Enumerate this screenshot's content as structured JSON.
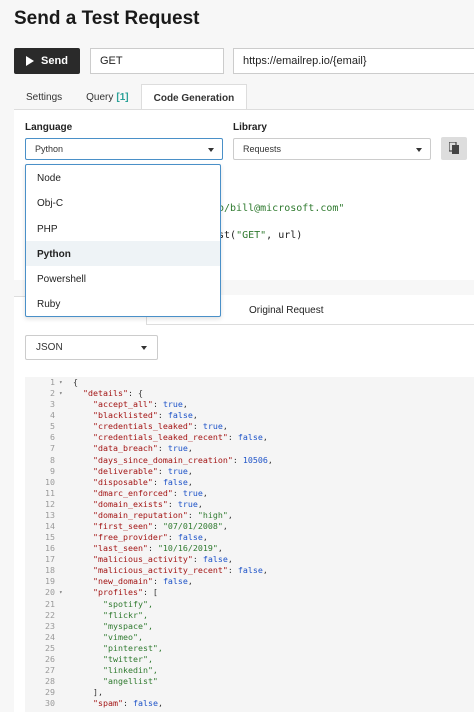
{
  "page": {
    "title": "Send a Test Request"
  },
  "request": {
    "send_label": "Send",
    "method": "GET",
    "url": "https://emailrep.io/{email}"
  },
  "tabs": [
    {
      "label": "Settings"
    },
    {
      "label": "Query",
      "count": "[1]"
    },
    {
      "label": "Code Generation",
      "active": true
    }
  ],
  "code_generation": {
    "language_label": "Language",
    "language_value": "Python",
    "library_label": "Library",
    "library_value": "Requests",
    "code_fragment_1": "o/bill@microsoft.com\"",
    "code_fragment_2a": "st(",
    "code_fragment_2b": "\"GET\"",
    "code_fragment_2c": ", url)",
    "language_options": [
      "Node",
      "Obj-C",
      "PHP",
      "Python",
      "Powershell",
      "Ruby"
    ],
    "selected_option": "Python"
  },
  "response": {
    "tab_label": "Original Request",
    "format": "JSON",
    "lines": [
      {
        "n": "1",
        "fold": "▾",
        "html": "{"
      },
      {
        "n": "2",
        "fold": "▾",
        "key": "details",
        "rest": ": {",
        "indent": "  "
      },
      {
        "n": "3",
        "key": "accept_all",
        "bool": "true",
        "indent": "    "
      },
      {
        "n": "4",
        "key": "blacklisted",
        "bool": "false",
        "indent": "    "
      },
      {
        "n": "5",
        "key": "credentials_leaked",
        "bool": "true",
        "indent": "    "
      },
      {
        "n": "6",
        "key": "credentials_leaked_recent",
        "bool": "false",
        "indent": "    "
      },
      {
        "n": "7",
        "key": "data_breach",
        "bool": "true",
        "indent": "    "
      },
      {
        "n": "8",
        "key": "days_since_domain_creation",
        "num": "10506",
        "indent": "    "
      },
      {
        "n": "9",
        "key": "deliverable",
        "bool": "true",
        "indent": "    "
      },
      {
        "n": "10",
        "key": "disposable",
        "bool": "false",
        "indent": "    "
      },
      {
        "n": "11",
        "key": "dmarc_enforced",
        "bool": "true",
        "indent": "    "
      },
      {
        "n": "12",
        "key": "domain_exists",
        "bool": "true",
        "indent": "    "
      },
      {
        "n": "13",
        "key": "domain_reputation",
        "str": "\"high\"",
        "indent": "    "
      },
      {
        "n": "14",
        "key": "first_seen",
        "str": "\"07/01/2008\"",
        "indent": "    "
      },
      {
        "n": "15",
        "key": "free_provider",
        "bool": "false",
        "indent": "    "
      },
      {
        "n": "16",
        "key": "last_seen",
        "str": "\"10/16/2019\"",
        "indent": "    "
      },
      {
        "n": "17",
        "key": "malicious_activity",
        "bool": "false",
        "indent": "    "
      },
      {
        "n": "18",
        "key": "malicious_activity_recent",
        "bool": "false",
        "indent": "    "
      },
      {
        "n": "19",
        "key": "new_domain",
        "bool": "false",
        "indent": "    "
      },
      {
        "n": "20",
        "fold": "▾",
        "key": "profiles",
        "rest": ": [",
        "indent": "    "
      },
      {
        "n": "21",
        "item": "\"spotify\",",
        "indent": "      "
      },
      {
        "n": "22",
        "item": "\"flickr\",",
        "indent": "      "
      },
      {
        "n": "23",
        "item": "\"myspace\",",
        "indent": "      "
      },
      {
        "n": "24",
        "item": "\"vimeo\",",
        "indent": "      "
      },
      {
        "n": "25",
        "item": "\"pinterest\",",
        "indent": "      "
      },
      {
        "n": "26",
        "item": "\"twitter\",",
        "indent": "      "
      },
      {
        "n": "27",
        "item": "\"linkedin\",",
        "indent": "      "
      },
      {
        "n": "28",
        "item": "\"angellist\"",
        "indent": "      "
      },
      {
        "n": "29",
        "plain": "],",
        "indent": "    "
      },
      {
        "n": "30",
        "key": "spam",
        "bool": "false",
        "indent": "    "
      }
    ]
  },
  "colors": {
    "accent": "#4a90c8",
    "send_bg": "#2a2a2a",
    "query_count": "#2aa198"
  }
}
